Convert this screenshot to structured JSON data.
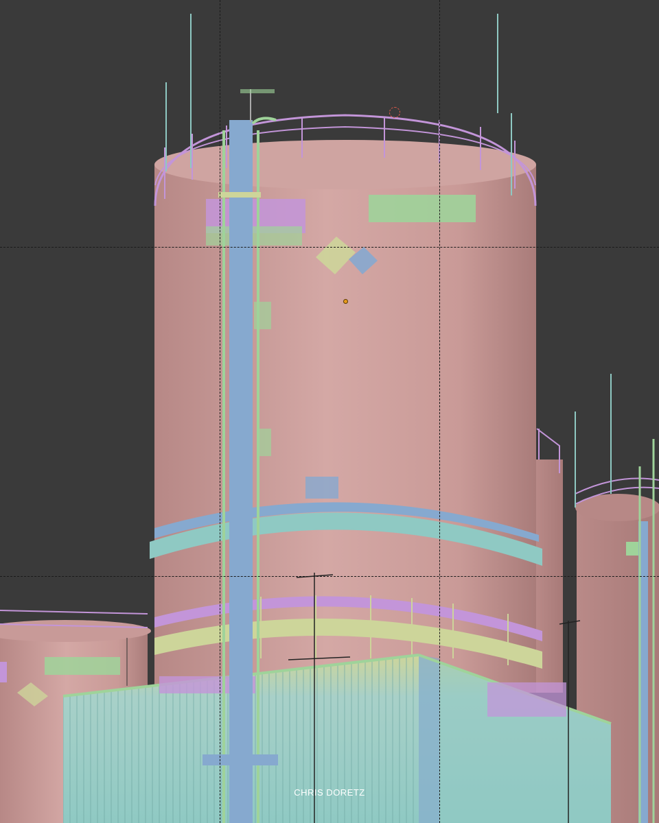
{
  "viewport": {
    "background": "#3a3a3a",
    "material_colors": {
      "tank_body": "#c89a98",
      "tank_shade": "#b28583",
      "uv_green": "#9fd39a",
      "uv_purple": "#c395d9",
      "uv_blue": "#86a9cf",
      "uv_teal": "#8fc9c3",
      "uv_yellow": "#cdd59a",
      "guide_line": "#1a1a1a"
    },
    "guides": "dashed-grid",
    "origin_marker": "orange-dot",
    "pivot_marker": "dashed-circle"
  },
  "watermark": {
    "text": "CHRIS DORETZ"
  }
}
